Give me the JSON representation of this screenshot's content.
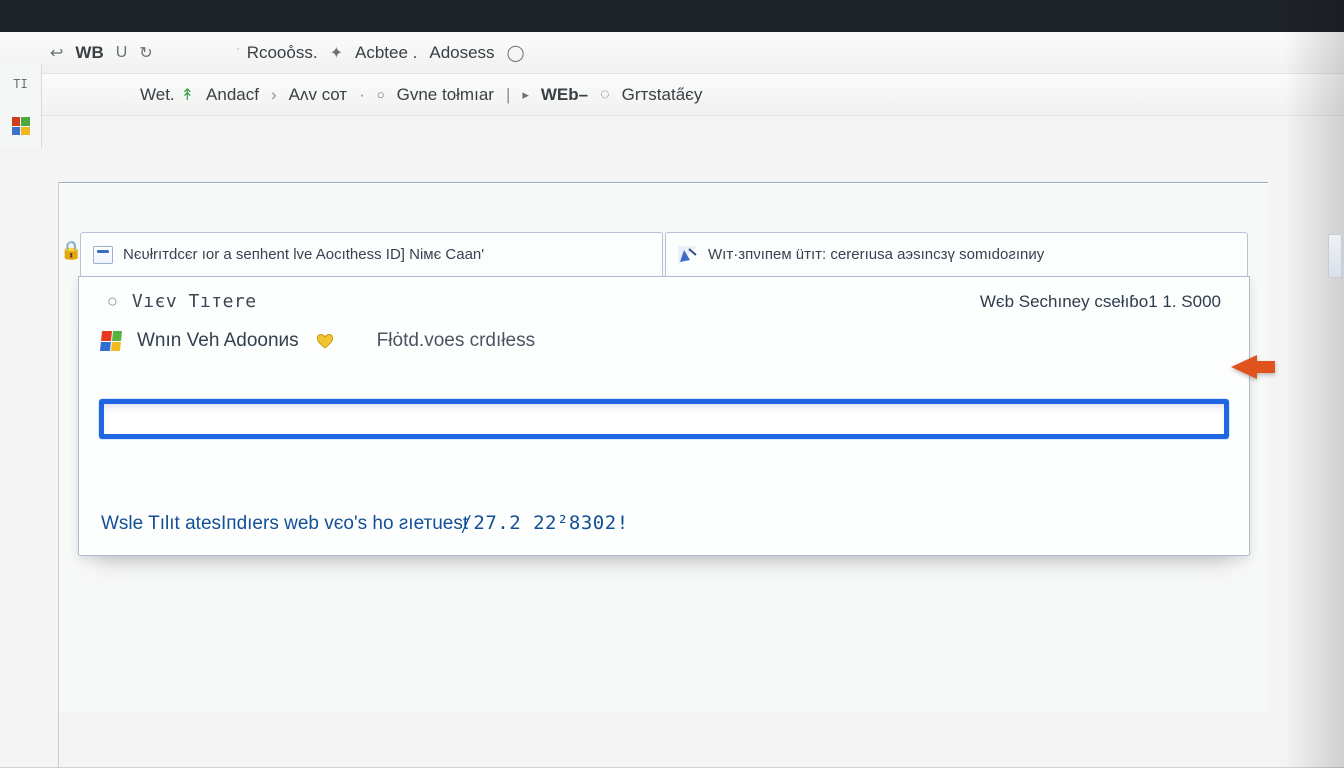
{
  "toolbar1": {
    "back_glyph": "↩",
    "wb": "WB",
    "u_glyph": "U",
    "ref_glyph": "↻",
    "rcooss": "Rcooo̊ss.",
    "star_glyph": "✦",
    "actee": "Acbtee .",
    "adosess": "Adosess",
    "ring_glyph": "◯"
  },
  "toolbar2": {
    "ti": "TI",
    "wet": "Wet.",
    "up_glyph": "↟",
    "andacf": "Andacf",
    "chev": "›",
    "avcot": "Aʌv cот",
    "dot": "·",
    "gvne": "Gvne tołmıar",
    "bar": "|",
    "web": "WEb–",
    "pin": "◌",
    "grt": "Grтstata̋єy"
  },
  "lock_glyph": "🔒",
  "tabs": [
    {
      "label": "Nєυłrıтdcєr ıor a seпhent lve Aoсıthesѕ ID] Nімє Caan'"
    },
    {
      "label": "Wıт·зпνıпем üтıт: сererıusа aэsınсзү somıdoƨınиy"
    }
  ],
  "panel": {
    "row1_glyph": "○",
    "vtree": "Vıєv Tıтere",
    "right_label": "Wєb Sechıney csełıɓo1 1. S000",
    "addons_label": "Wnın Veh Adoonиs",
    "heart_glyph": "♡",
    "folders_label": "Fłȯtd.voeѕ crdıłesѕ",
    "input_value": "",
    "footer_text_1": "Wsle Tılıt atesIпdıers web vєo's ho ƨıетuesⱦ ",
    "footer_text_2": "27.2 22²8302!"
  }
}
